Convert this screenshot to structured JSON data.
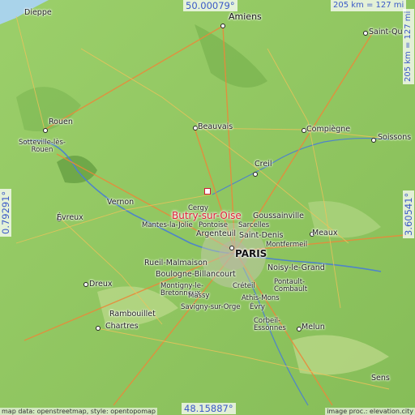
{
  "highlight": {
    "name": "Butry-sur-Oise",
    "color": "#e0203a"
  },
  "coords": {
    "north": "50.00079°",
    "south": "48.15887°",
    "west": "0.79291°",
    "east": "3.60541°",
    "scale_top": "205 km = 127 mi",
    "scale_right": "205 km = 127 mi"
  },
  "places": {
    "paris": "PARIS",
    "amiens": "Amiens",
    "dieppe": "Dieppe",
    "saint_quentin": "Saint-Qu",
    "rouen": "Rouen",
    "sotteville": "Sotteville-lès-Rouen",
    "beauvais": "Beauvais",
    "compiegne": "Compiègne",
    "soissons": "Soissons",
    "creil": "Creil",
    "vernon": "Vernon",
    "evreux": "Évreux",
    "cergy": "Cergy",
    "goussainville": "Goussainville",
    "mantes": "Mantes-la-Jolie",
    "pontoise": "Pontoise",
    "sarcelles": "Sarcelles",
    "meaux": "Meaux",
    "argenteuil": "Argenteuil",
    "saint_denis": "Saint-Denis",
    "montfermeil": "Montfermeil",
    "rueil": "Rueil-Malmaison",
    "noisy": "Noisy-le-Grand",
    "boulogne": "Boulogne-Billancourt",
    "pontault": "Pontault-Combault",
    "creteil": "Créteil",
    "dreux": "Dreux",
    "montigny": "Montigny-le-Bretonneux",
    "massy": "Massy",
    "athis": "Athis-Mons",
    "savigny": "Savigny-sur-Orge",
    "evry": "Évry",
    "rambouillet": "Rambouillet",
    "corbeil": "Corbeil-Essonnes",
    "melun": "Melun",
    "chartres": "Chartres",
    "sens": "Sens"
  },
  "credits": {
    "left": "map data: openstreetmap, style: opentopomap",
    "right": "image proc.: elevation.city"
  }
}
